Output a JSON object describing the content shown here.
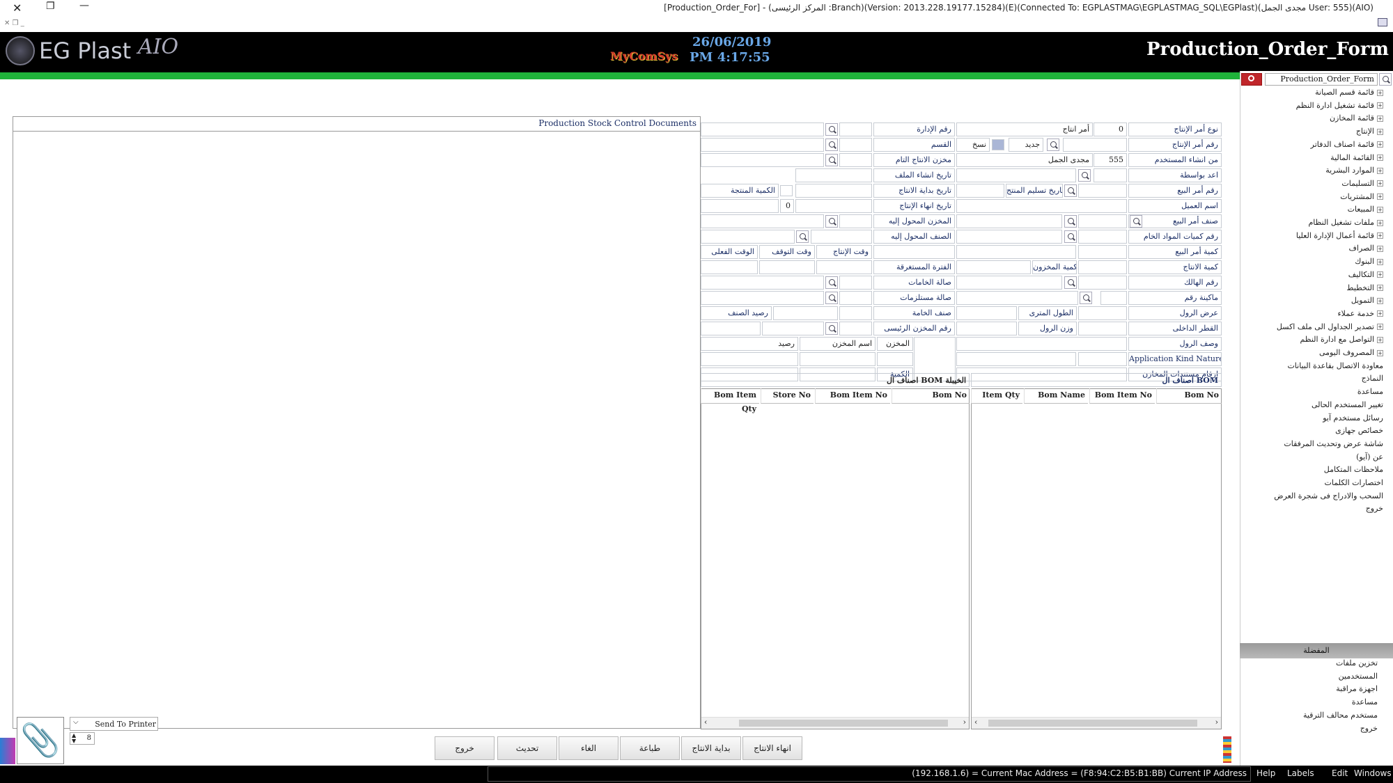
{
  "window": {
    "title": "[Production_Order_For] - (المركز الرئيسى :Branch)(Version: 2013.228.19177.15284)(E)(Connected To: EGPLASTMAG\\EGPLASTMAG_SQL\\EGPlast)(مجدى الجمل User: 555)(AIO)"
  },
  "header": {
    "logo_text": "EG Plast",
    "logo_sub": "AIO",
    "brand": "MyComSys",
    "date": "26/06/2019",
    "time": "PM 4:17:55",
    "form_title": "Production_Order_Form"
  },
  "sidebar": {
    "search_value": "Production_Order_Form",
    "tree_items": [
      "قائمة قسم الصيانة",
      "قائمة تشغيل ادارة النظم",
      "قائمة المخازن",
      "الإنتاج",
      "قائمة اصناف الدفاتر",
      "القائمة المالية",
      "الموارد البشرية",
      "التسليمات",
      "المشتريات",
      "المبيعات",
      "ملفات تشغيل النظام",
      "قائمة أعمال الإدارة العليا",
      "الصراف",
      "البنوك",
      "التكاليف",
      "التخطيط",
      "التمويل",
      "خدمة عملاء",
      "تصدير الجداول الى ملف اكسل",
      "التواصل مع ادارة النظم",
      "المصروف اليومى",
      "معاودة الاتصال بقاعدة البيانات",
      "النماذج",
      "مساعدة",
      "تغيير المستخدم الحالى",
      "رسائل مستخدم آيو",
      "خصائص جهازى",
      "شاشة عرض وتحديث المرفقات",
      "عن (آيو)",
      "ملاحظات المتكامل",
      "اختصارات الكلمات",
      "السحب والادراج فى شجرة العرض",
      "خروج"
    ],
    "favorites_header": "المفضلة",
    "favorites": [
      "تخزين ملفات",
      "المستخدمين",
      "اجهزة مراقبة",
      "مساعدة",
      "مستخدم محالف الترقية",
      "خروج"
    ]
  },
  "left_panel": {
    "title": "Production Stock Control Documents"
  },
  "form": {
    "order_type_label": "نوع أمر الإنتاج",
    "order_type_value": "0",
    "order_type_text": "أمر انتاج",
    "admin_no_label": "رقم الإدارة",
    "order_no_label": "رقم أمر الإنتاج",
    "new_label": "جديد",
    "copy_label": "نسخ",
    "dept_label": "القسم",
    "created_by_label": "من انشاء المستخدم",
    "created_by_code": "555",
    "created_by_name": "مجدى الجمل",
    "finished_store_label": "مخزن الانتاج التام",
    "prepared_by_label": "اعد بواسطة",
    "file_date_label": "تاريخ انشاء الملف",
    "sales_order_label": "رقم أمر البيع",
    "delivery_date_label": "تاريخ تسليم المنتج",
    "start_date_label": "تاريخ بداية الانتاج",
    "produced_qty_label": "الكمية المنتجة",
    "customer_label": "اسم العميل",
    "end_date_label": "تاريخ انهاء الإنتاج",
    "end_value": "0",
    "sales_item_label": "صنف أمر البيع",
    "transfer_store_label": "المخزن المحول إليه",
    "raw_qty_no_label": "رقم كميات المواد الخام",
    "transfer_item_label": "الصنف المحول إليه",
    "sales_qty_label": "كمية أمر البيع",
    "prod_time_label": "وقت الإنتاج",
    "stop_time_label": "وقت التوقف",
    "actual_time_label": "الوقت الفعلى",
    "prod_qty_label": "كمية الانتاج",
    "stock_qty_label": "كمية المخزون",
    "elapsed_label": "الفترة المستغرقة",
    "waste_no_label": "رقم الهالك",
    "raw_hall_label": "صالة الخامات",
    "machine_no_label": "ماكينة رقم",
    "supplies_hall_label": "صالة مستلزمات",
    "roll_width_label": "عرض الرول",
    "meter_length_label": "الطول المترى",
    "raw_item_label": "صنف الخامة",
    "item_balance_label": "رصيد الصنف",
    "inner_dia_label": "القطر الداخلى",
    "roll_weight_label": "وزن الرول",
    "main_store_label": "رقم المخزن الرئيسى",
    "roll_desc_label": "وصف الرول",
    "store_label": "المخزن",
    "store_name_label": "اسم المخزن",
    "balance_label": "رصيد",
    "app_kind_label": "Application Kind Nature",
    "store_docs_label": "ارقام مستندات المخازن",
    "quantity_label": "الكمية"
  },
  "grids": {
    "bom_items_title": "اصناف ال BOM",
    "bom_items_cols": [
      "Bom No",
      "Bom Item No",
      "Bom Name",
      "Item Qty"
    ],
    "bom_ready_title": "اصناف ال BOM الخيبلة",
    "bom_ready_cols": [
      "Bom No",
      "Bom Item No",
      "Store No",
      "Bom Item Qty"
    ]
  },
  "bottom": {
    "printer_label": "Send To Printer",
    "copies": "8",
    "buttons": [
      "انهاء الانتاج",
      "بداية الانتاج",
      "طباعة",
      "الغاء",
      "تحديث",
      "خروج"
    ]
  },
  "status": {
    "text": "(192.168.1.6) = Current Mac Address = (F8:94:C2:B5:B1:BB) Current IP Address",
    "menu": [
      "Help",
      "Labels",
      "Edit",
      "Windows"
    ]
  },
  "colors": {
    "header_bg": "#000000",
    "accent_green": "#1fb33a",
    "date_blue": "#6aa8e8",
    "search_red": "#c0262b"
  }
}
